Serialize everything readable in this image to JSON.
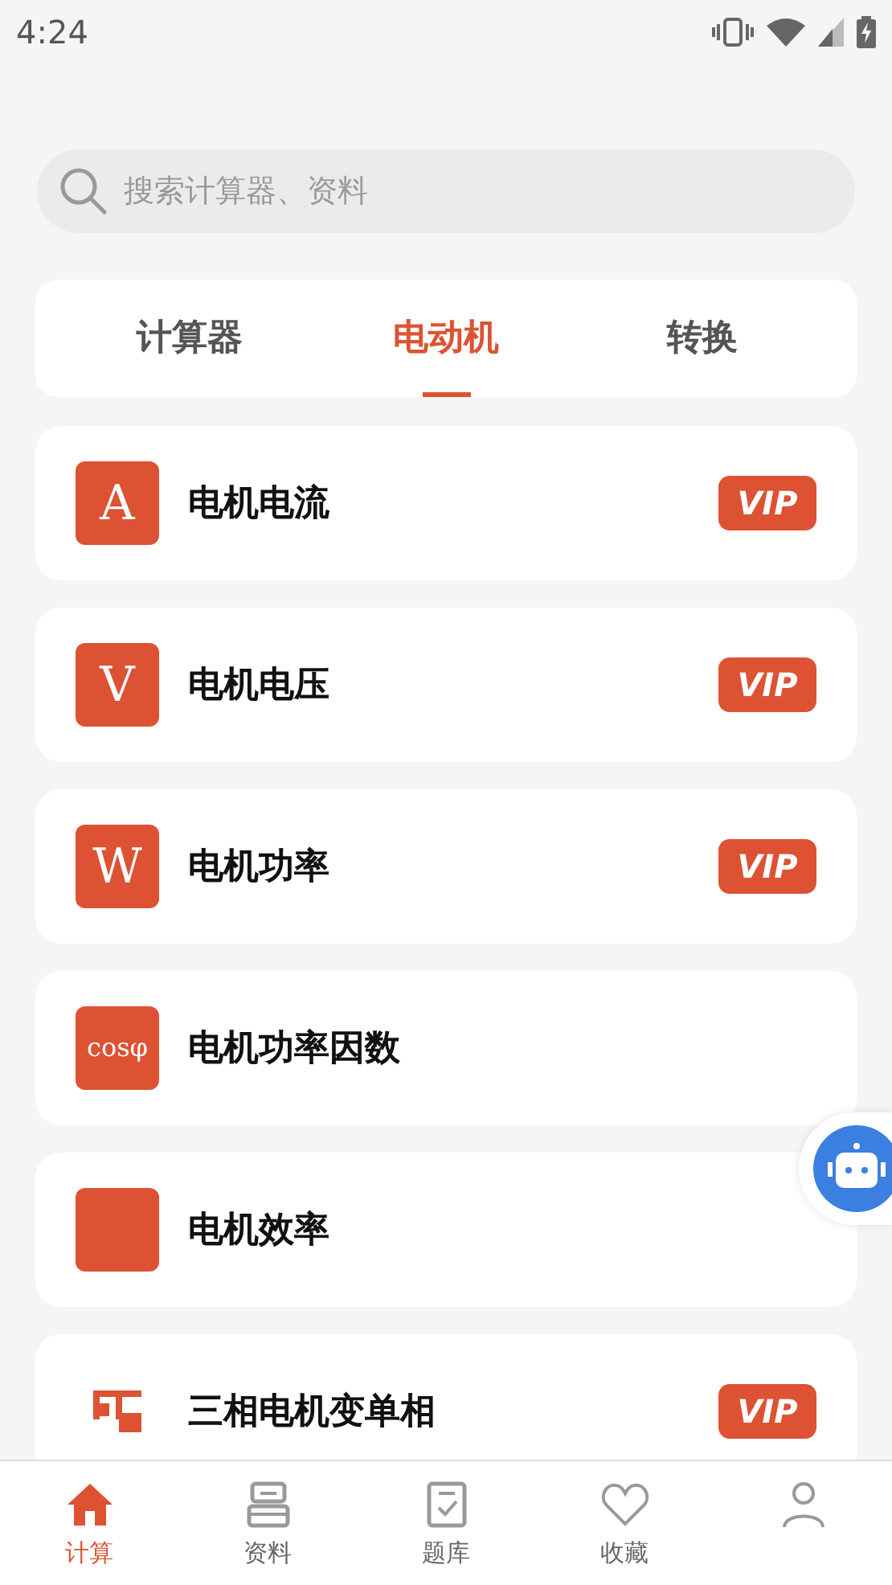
{
  "status_bar": {
    "time": "4:24"
  },
  "search": {
    "placeholder": "搜索计算器、资料"
  },
  "tabs": [
    {
      "label": "计算器",
      "selected": false
    },
    {
      "label": "电动机",
      "selected": true
    },
    {
      "label": "转换",
      "selected": false
    }
  ],
  "items": [
    {
      "kind": "letter",
      "symbol": "A",
      "title": "电机电流",
      "badge": "VIP"
    },
    {
      "kind": "letter",
      "symbol": "V",
      "title": "电机电压",
      "badge": "VIP"
    },
    {
      "kind": "letter",
      "symbol": "W",
      "title": "电机功率",
      "badge": "VIP"
    },
    {
      "kind": "letter",
      "symbol": "cosφ",
      "title": "电机功率因数"
    },
    {
      "kind": "blank",
      "title": "电机效率"
    },
    {
      "kind": "circuit",
      "title": "三相电机变单相",
      "badge": "VIP"
    }
  ],
  "bottom_nav": [
    {
      "kind": "home",
      "label": "计算",
      "selected": true
    },
    {
      "kind": "docs",
      "label": "资料",
      "selected": false
    },
    {
      "kind": "quiz",
      "label": "题库",
      "selected": false
    },
    {
      "kind": "heart",
      "label": "收藏",
      "selected": false
    },
    {
      "kind": "person",
      "selected": false
    }
  ]
}
